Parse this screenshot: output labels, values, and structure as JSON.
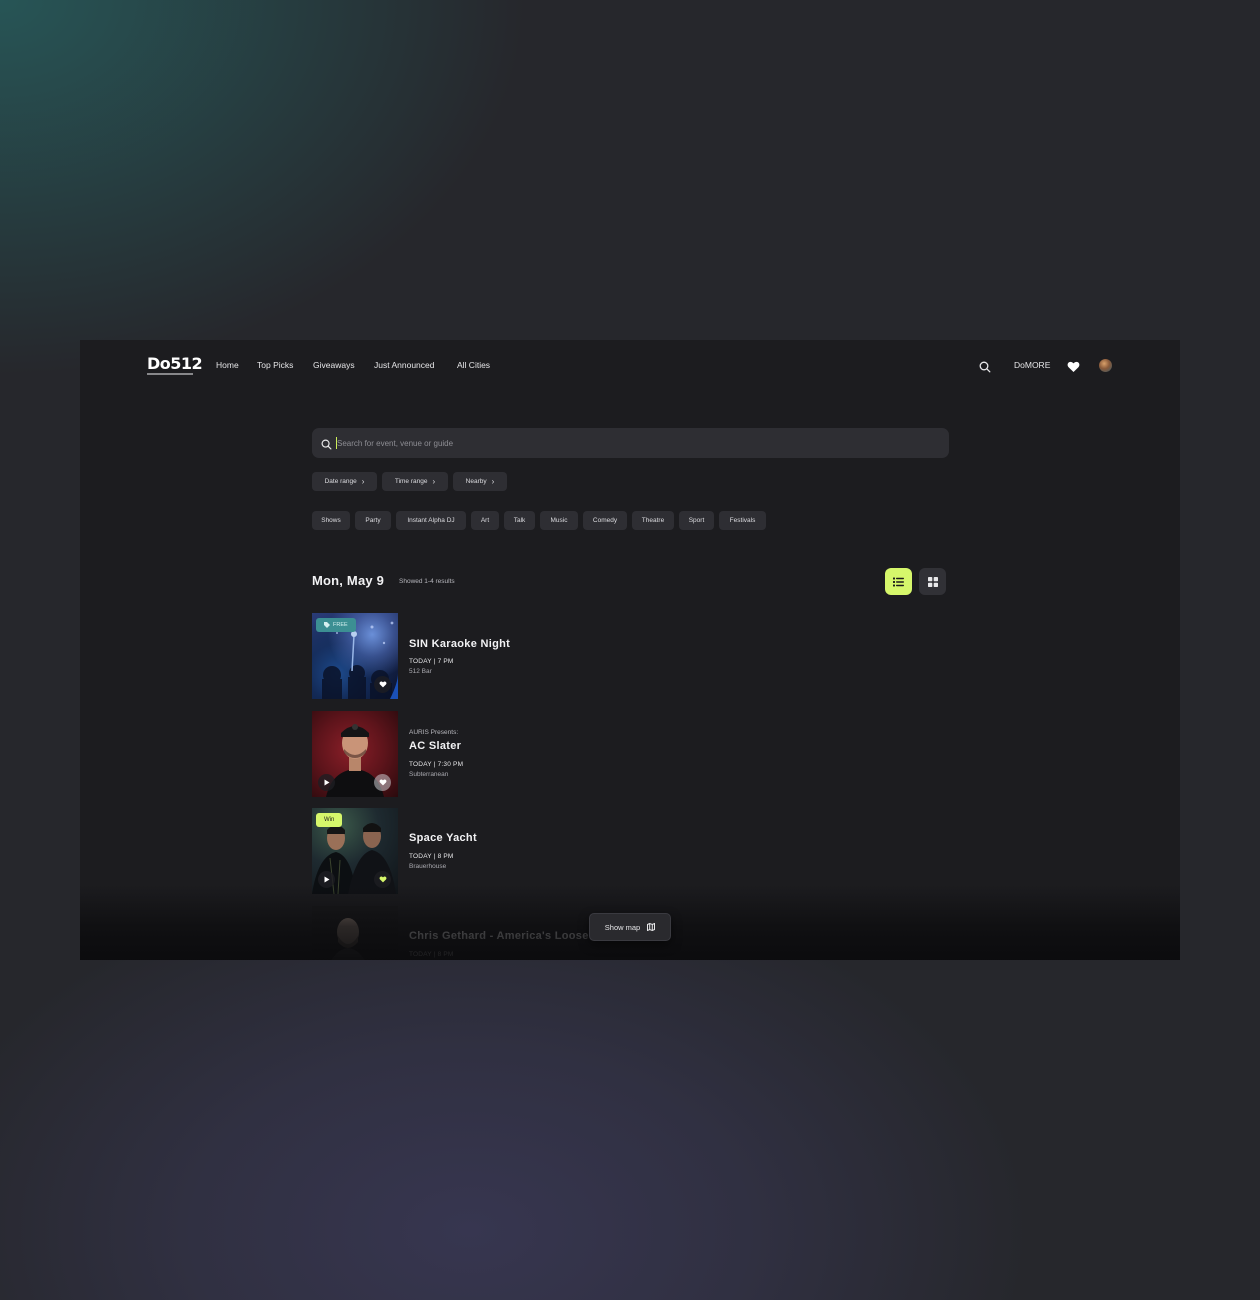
{
  "brand": {
    "name": "Do512"
  },
  "nav": {
    "links": [
      "Home",
      "Top Picks",
      "Giveaways",
      "Just Announced",
      "All Cities"
    ],
    "domore": "DoMORE"
  },
  "search": {
    "placeholder": "Search for event, venue or guide",
    "value": ""
  },
  "filters": [
    "Date range",
    "Time range",
    "Nearby"
  ],
  "categories": [
    "Shows",
    "Party",
    "Instant Alpha DJ",
    "Art",
    "Talk",
    "Music",
    "Comedy",
    "Theatre",
    "Sport",
    "Festivals"
  ],
  "listing": {
    "date": "Mon, May 9",
    "results": "Showed 1-4 results",
    "active_view": "list"
  },
  "events": [
    {
      "badge": "FREE",
      "title": "SIN Karaoke Night",
      "when": "TODAY | 7 PM",
      "venue": "512 Bar"
    },
    {
      "presenter": "AURIS Presents:",
      "title": "AC Slater",
      "when": "TODAY | 7:30 PM",
      "venue": "Subterranean"
    },
    {
      "badge": "Win",
      "title": "Space Yacht",
      "when": "TODAY | 8 PM",
      "venue": "Brauerhouse"
    },
    {
      "title": "Chris Gethard - America's Loose",
      "when": "TODAY | 8 PM"
    }
  ],
  "map_button": "Show map",
  "colors": {
    "accent": "#d6f76b",
    "free_badge": "#3c8f93",
    "surface": "#1c1c1f",
    "chip": "#2e2e33"
  }
}
